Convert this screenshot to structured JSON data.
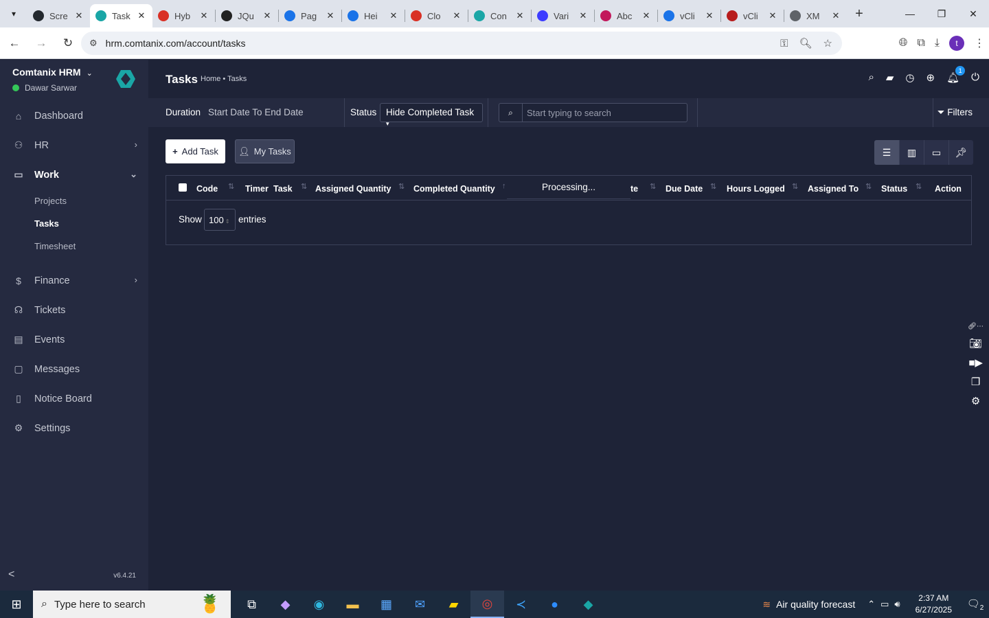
{
  "browser": {
    "tabs": [
      {
        "label": "Scre",
        "icon": "github-icon",
        "color": "#24292f"
      },
      {
        "label": "Task",
        "icon": "comtanix-icon",
        "color": "#1aa6a6",
        "active": true
      },
      {
        "label": "Hyb",
        "icon": "tag-icon",
        "color": "#d93025"
      },
      {
        "label": "JQu",
        "icon": "target-icon",
        "color": "#222222"
      },
      {
        "label": "Pag",
        "icon": "wave-icon",
        "color": "#1a73e8"
      },
      {
        "label": "Hei",
        "icon": "scale-icon",
        "color": "#1a73e8"
      },
      {
        "label": "Clo",
        "icon": "tag-icon",
        "color": "#d93025"
      },
      {
        "label": "Con",
        "icon": "comtanix-icon",
        "color": "#1aa6a6"
      },
      {
        "label": "Vari",
        "icon": "x-icon",
        "color": "#3c3cff"
      },
      {
        "label": "Abc",
        "icon": "diamond-icon",
        "color": "#c2185b"
      },
      {
        "label": "vCli",
        "icon": "check-icon",
        "color": "#1a73e8"
      },
      {
        "label": "vCli",
        "icon": "v-icon",
        "color": "#b71c1c"
      },
      {
        "label": "XM",
        "icon": "globe-icon",
        "color": "#5f6368"
      }
    ],
    "url": "hrm.comtanix.com/account/tasks",
    "profile_initial": "t"
  },
  "sidebar": {
    "company": "Comtanix HRM",
    "user": "Dawar Sarwar",
    "items": [
      {
        "label": "Dashboard",
        "icon": "home-icon"
      },
      {
        "label": "HR",
        "icon": "users-icon",
        "has_children": true
      },
      {
        "label": "Work",
        "icon": "briefcase-icon",
        "has_children": true,
        "open": true,
        "children": [
          {
            "label": "Projects"
          },
          {
            "label": "Tasks",
            "active": true
          },
          {
            "label": "Timesheet"
          }
        ]
      },
      {
        "label": "Finance",
        "icon": "dollar-icon",
        "has_children": true
      },
      {
        "label": "Tickets",
        "icon": "headset-icon"
      },
      {
        "label": "Events",
        "icon": "calendar-icon"
      },
      {
        "label": "Messages",
        "icon": "message-icon"
      },
      {
        "label": "Notice Board",
        "icon": "clipboard-icon"
      },
      {
        "label": "Settings",
        "icon": "gear-icon"
      }
    ],
    "version": "v6.4.21"
  },
  "header": {
    "title": "Tasks",
    "breadcrumb": "Home • Tasks",
    "notification_count": "1"
  },
  "filters": {
    "duration_label": "Duration",
    "date_range": "Start Date To End Date",
    "status_label": "Status",
    "status_value": "Hide Completed Task",
    "search_placeholder": "Start typing to search",
    "filters_label": "Filters"
  },
  "actions": {
    "add_task": "Add Task",
    "my_tasks": "My Tasks"
  },
  "table": {
    "columns": [
      "Code",
      "Timer",
      "Task",
      "Assigned Quantity",
      "Completed Quantity",
      "te",
      "Due Date",
      "Hours Logged",
      "Assigned To",
      "Status",
      "Action"
    ],
    "processing": "Processing...",
    "show_label": "Show",
    "page_length": "100",
    "entries_label": "entries"
  },
  "taskbar": {
    "search_placeholder": "Type here to search",
    "weather": "Air quality forecast",
    "time": "2:37 AM",
    "date": "6/27/2025",
    "notification_count": "2"
  },
  "colors": {
    "content_bg": "#1e2337",
    "sidebar_bg": "#252a40",
    "online": "#35c759",
    "accent": "#2196f3"
  }
}
